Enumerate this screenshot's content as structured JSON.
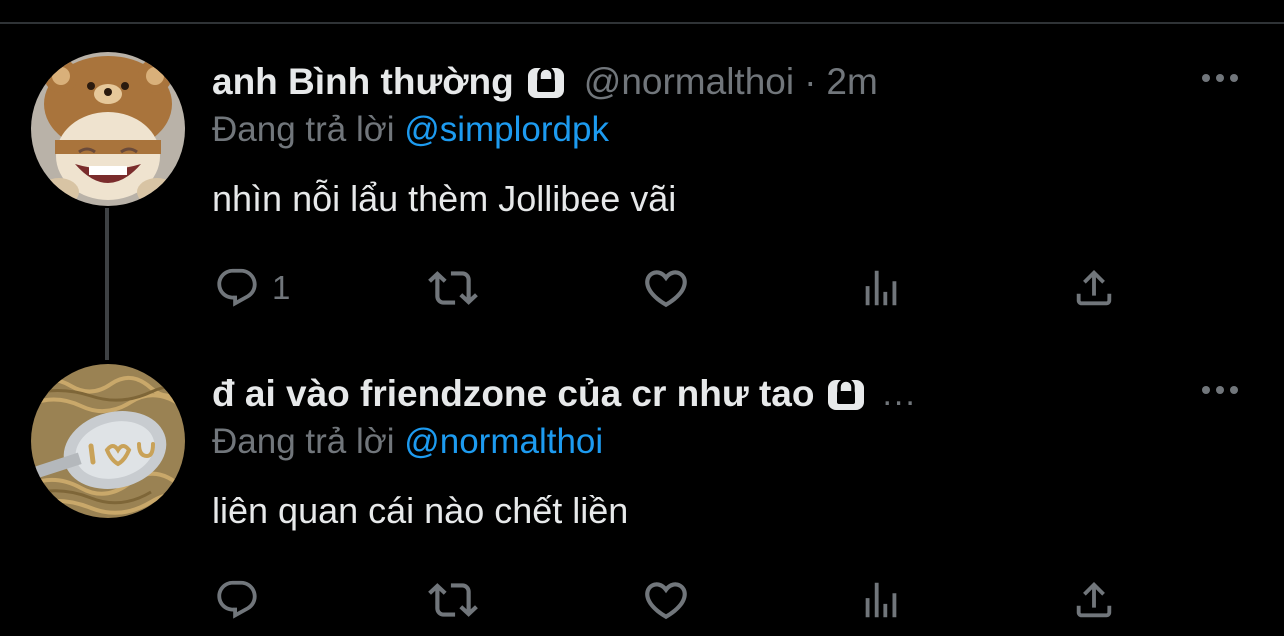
{
  "tweets": [
    {
      "display_name": "anh Bình thường",
      "protected": true,
      "handle": "@normalthoi",
      "separator": "·",
      "time": "2m",
      "reply_prefix": "Đang trả lời",
      "reply_to": "@simplordpk",
      "text": "nhìn nỗi lẩu thèm Jollibee vãi",
      "reply_count": "1",
      "avatar_icon": "bear-hat-cat-avatar"
    },
    {
      "display_name": "đ ai vào friendzone của cr như tao",
      "protected": true,
      "truncation": "...",
      "reply_prefix": "Đang trả lời",
      "reply_to": "@normalthoi",
      "text": "liên quan cái nào chết liền",
      "reply_count": "",
      "avatar_icon": "spoon-noodles-avatar"
    }
  ],
  "colors": {
    "background": "#000000",
    "primary_text": "#e7e9ea",
    "secondary_text": "#71767b",
    "link": "#1d9bf0",
    "thread_line": "#3e4144"
  },
  "icons": [
    "reply-icon",
    "retweet-icon",
    "like-icon",
    "views-icon",
    "share-icon",
    "more-icon",
    "lock-icon"
  ]
}
